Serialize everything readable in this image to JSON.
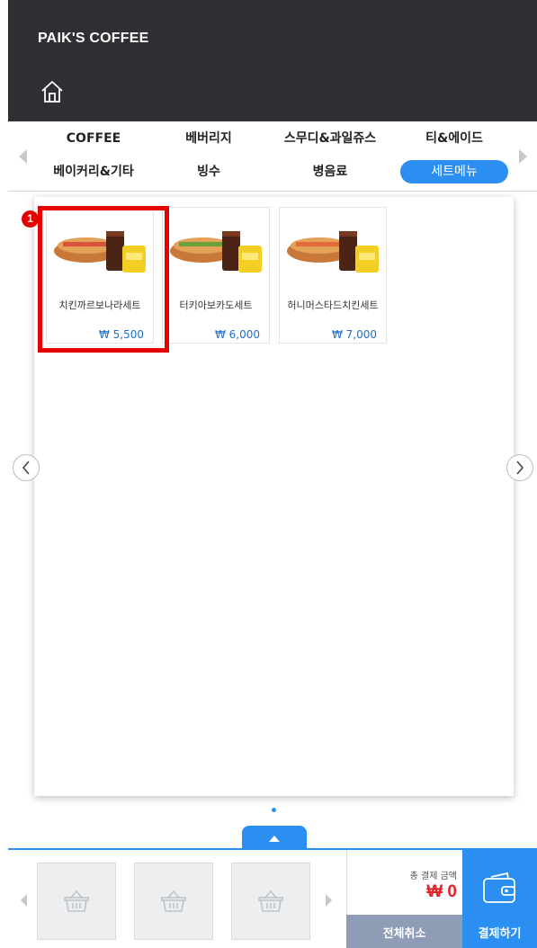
{
  "header": {
    "brand": "PAIK'S COFFEE",
    "home_icon": "home-icon"
  },
  "categories": {
    "row1": [
      "COFFEE",
      "베버리지",
      "스무디&과일쥬스",
      "티&에이드"
    ],
    "row2": [
      "베이커리&기타",
      "빙수",
      "병음료",
      "세트메뉴"
    ],
    "active": "세트메뉴"
  },
  "products": [
    {
      "name": "치킨까르보나라세트",
      "price": "₩ 5,500"
    },
    {
      "name": "터키아보카도세트",
      "price": "₩ 6,000"
    },
    {
      "name": "허니머스타드치킨세트",
      "price": "₩ 7,000"
    }
  ],
  "annotation": {
    "marker": "1"
  },
  "cart": {
    "slot_icon": "basket-icon",
    "total_label": "총 결제 금액",
    "total_value": "₩ 0",
    "cancel_label": "전체취소",
    "pay_label": "결제하기",
    "pay_icon": "wallet-icon"
  },
  "colors": {
    "header": "#2f3033",
    "accent": "#2a8ff1",
    "price": "#1f6fc8",
    "total": "#e0242c",
    "highlight": "#e60000",
    "cancel": "#8e9db5"
  }
}
